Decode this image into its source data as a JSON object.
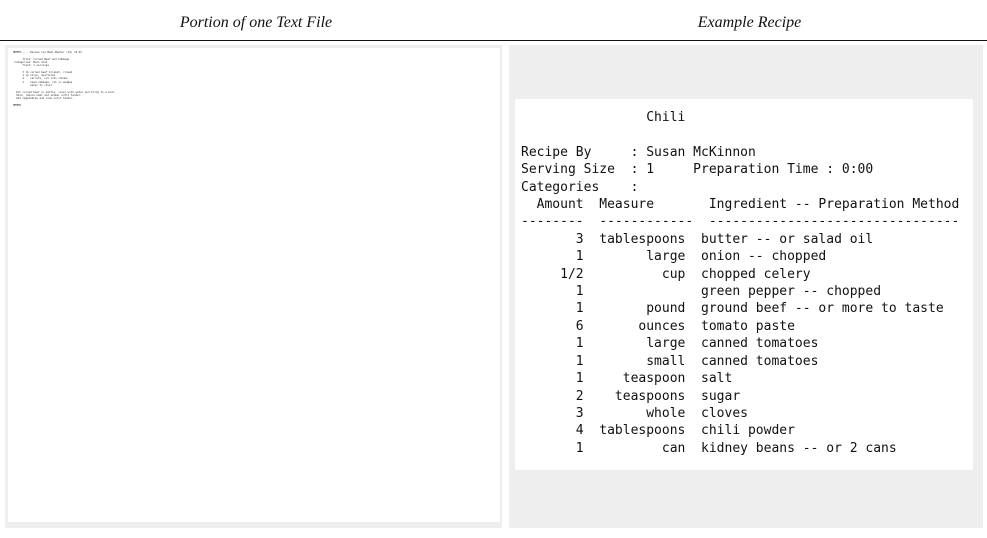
{
  "headers": {
    "left": "Portion of one Text File",
    "right": "Example Recipe"
  },
  "left_text_excerpt": "MMMMM----- Recipe via Meal-Master (tm) v8.05\n \n      Title: Corned Beef and Cabbage\n Categories: Main dish\n      Yield: 1 servings\n \n      3 lb corned beef brisket, rinsed\n      1 lg onion, quartered\n      2    carrots, cut into chunks\n      1    head cabbage, cut in wedges\n           water to cover\n \n  Put corned beef in kettle, cover with water and bring to a boil.\n  Skim, reduce heat and simmer until tender.\n  Add vegetables and cook until tender.\n \nMMMMM\n",
  "recipe": {
    "text": "                Chili\n\nRecipe By     : Susan McKinnon\nServing Size  : 1     Preparation Time : 0:00\nCategories    :\n  Amount  Measure       Ingredient -- Preparation Method\n--------  ------------  --------------------------------\n       3  tablespoons  butter -- or salad oil\n       1        large  onion -- chopped\n     1/2          cup  chopped celery\n       1               green pepper -- chopped\n       1        pound  ground beef -- or more to taste\n       6       ounces  tomato paste\n       1        large  canned tomatoes\n       1        small  canned tomatoes\n       1     teaspoon  salt\n       2    teaspoons  sugar\n       3        whole  cloves\n       4  tablespoons  chili powder\n       1          can  kidney beans -- or 2 cans"
  }
}
